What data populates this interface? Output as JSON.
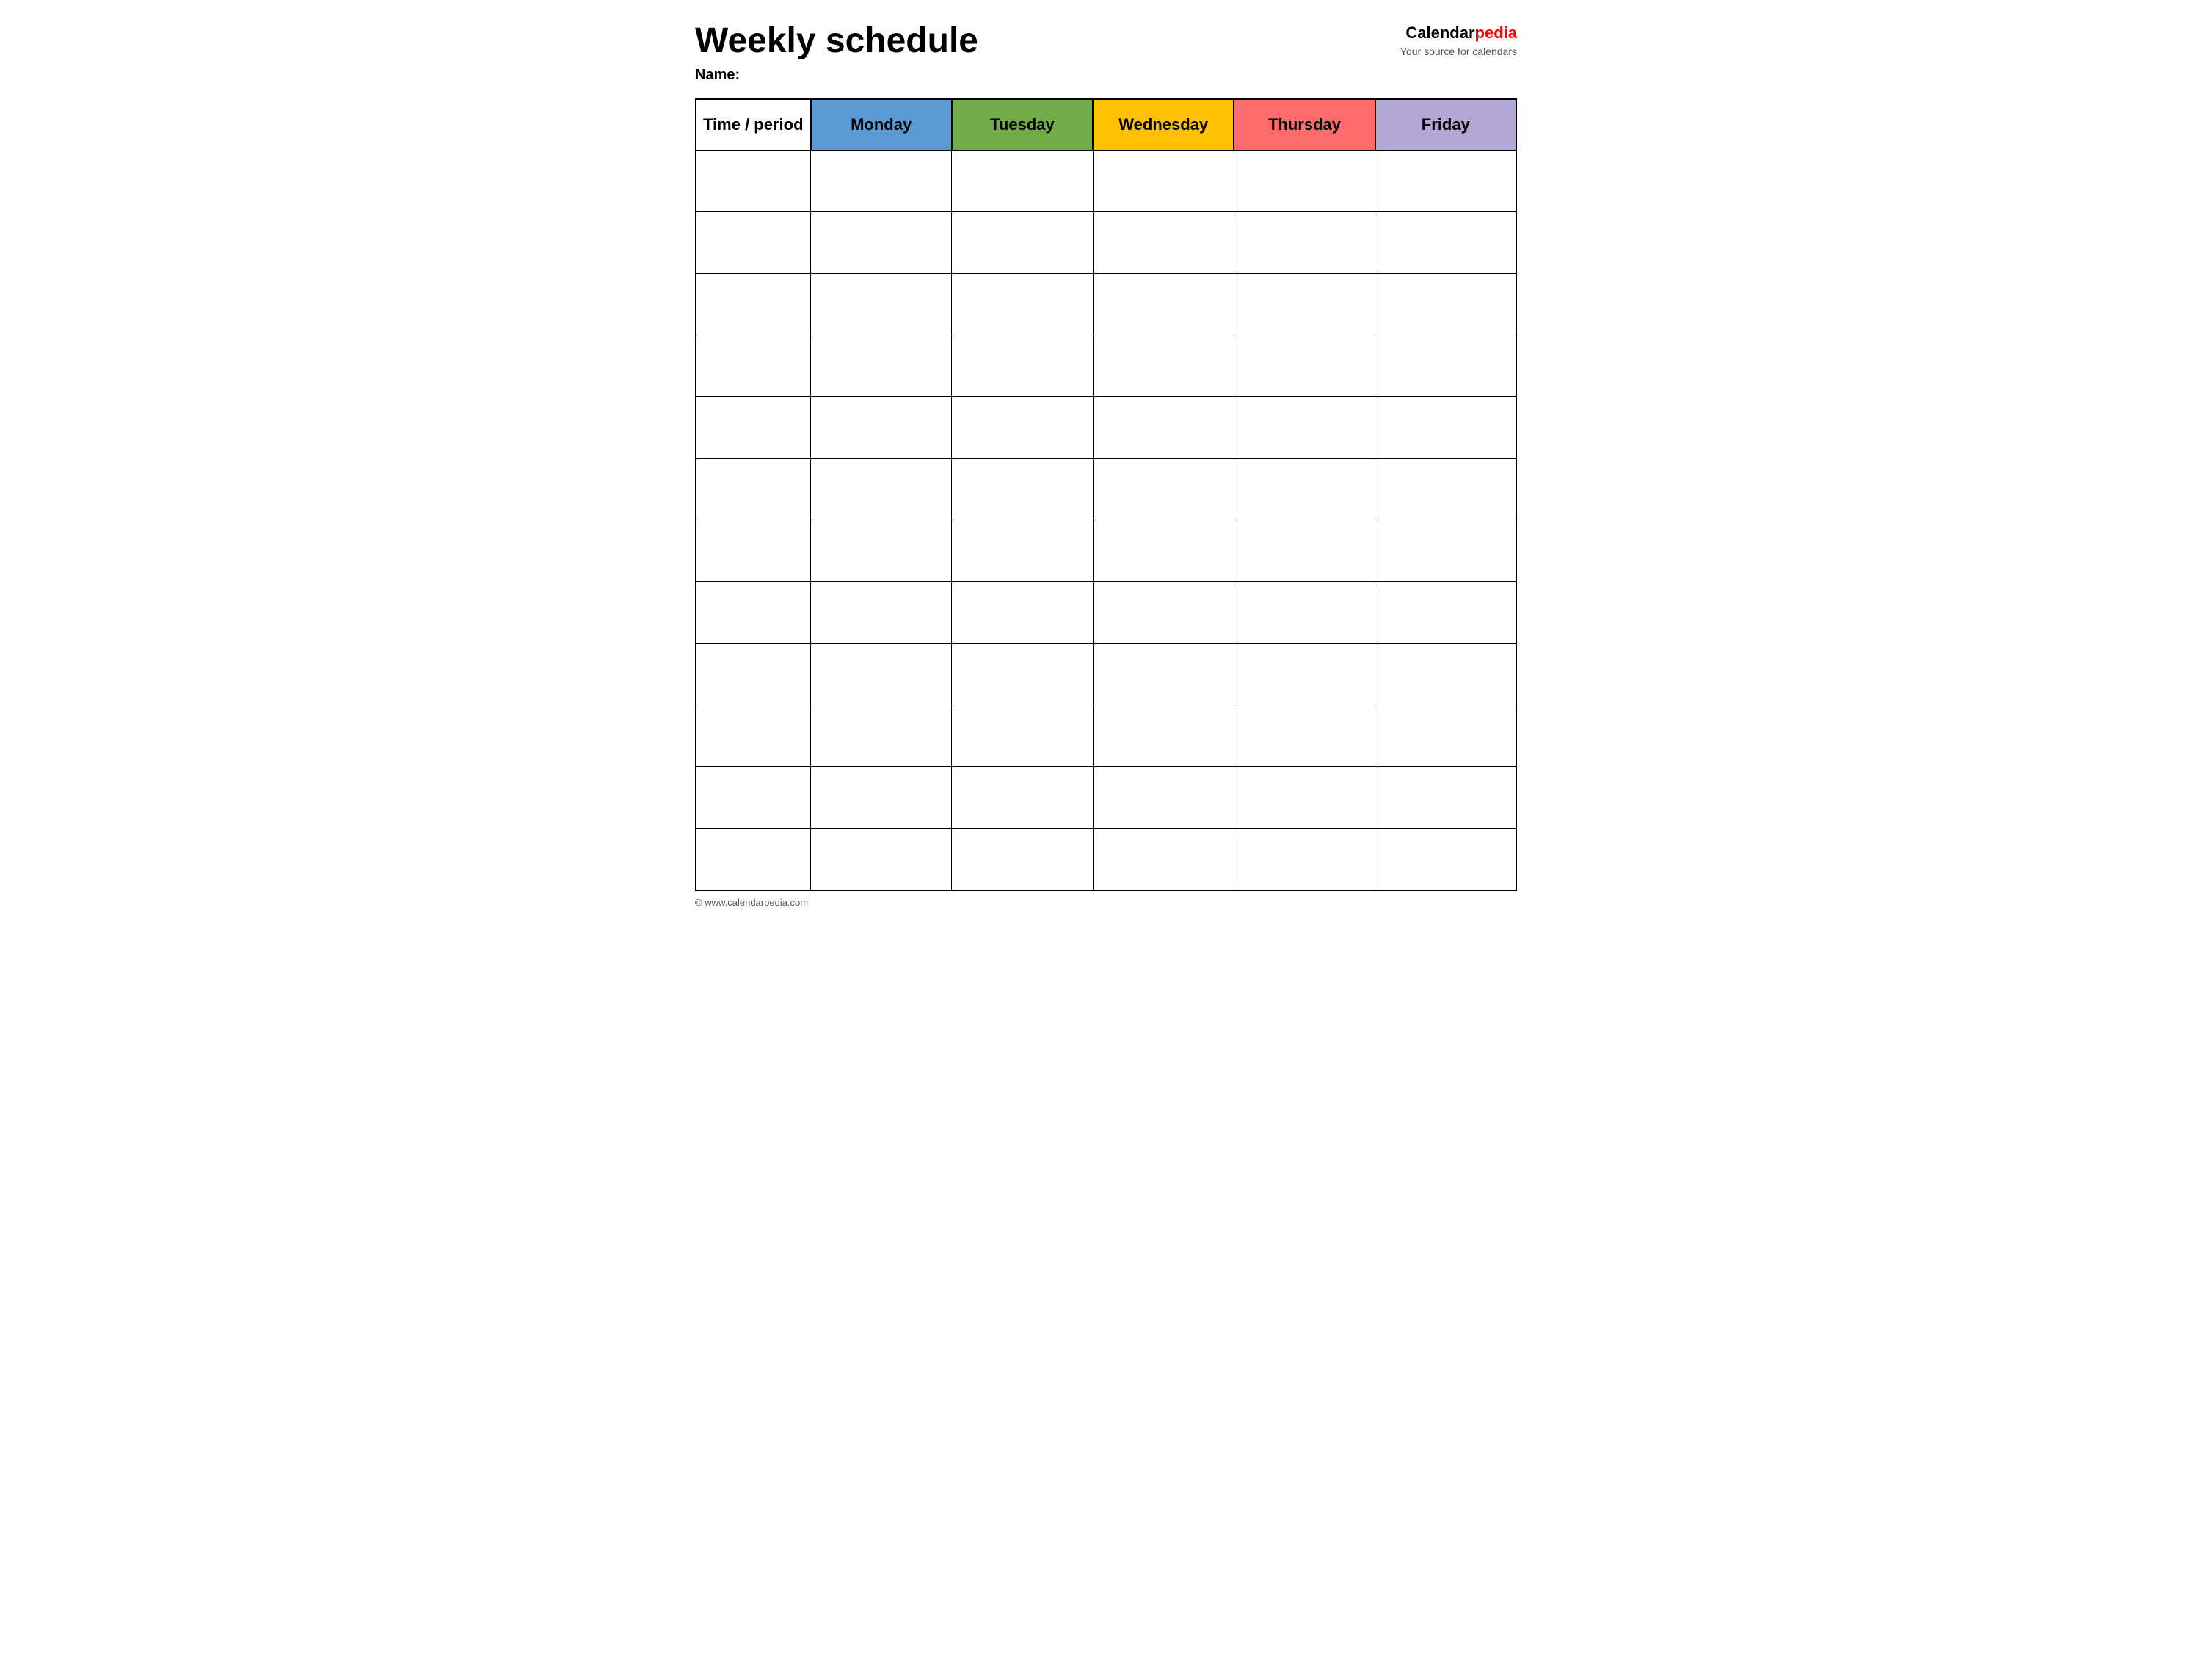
{
  "header": {
    "title": "Weekly schedule",
    "name_label": "Name:",
    "logo_text_black": "Calendar",
    "logo_text_red": "pedia",
    "logo_tagline": "Your source for calendars"
  },
  "table": {
    "columns": [
      {
        "key": "time",
        "label": "Time / period",
        "color_class": "col-time"
      },
      {
        "key": "monday",
        "label": "Monday",
        "color_class": "col-monday"
      },
      {
        "key": "tuesday",
        "label": "Tuesday",
        "color_class": "col-tuesday"
      },
      {
        "key": "wednesday",
        "label": "Wednesday",
        "color_class": "col-wednesday"
      },
      {
        "key": "thursday",
        "label": "Thursday",
        "color_class": "col-thursday"
      },
      {
        "key": "friday",
        "label": "Friday",
        "color_class": "col-friday"
      }
    ],
    "row_count": 12
  },
  "footer": {
    "copyright": "© www.calendarpedia.com"
  }
}
